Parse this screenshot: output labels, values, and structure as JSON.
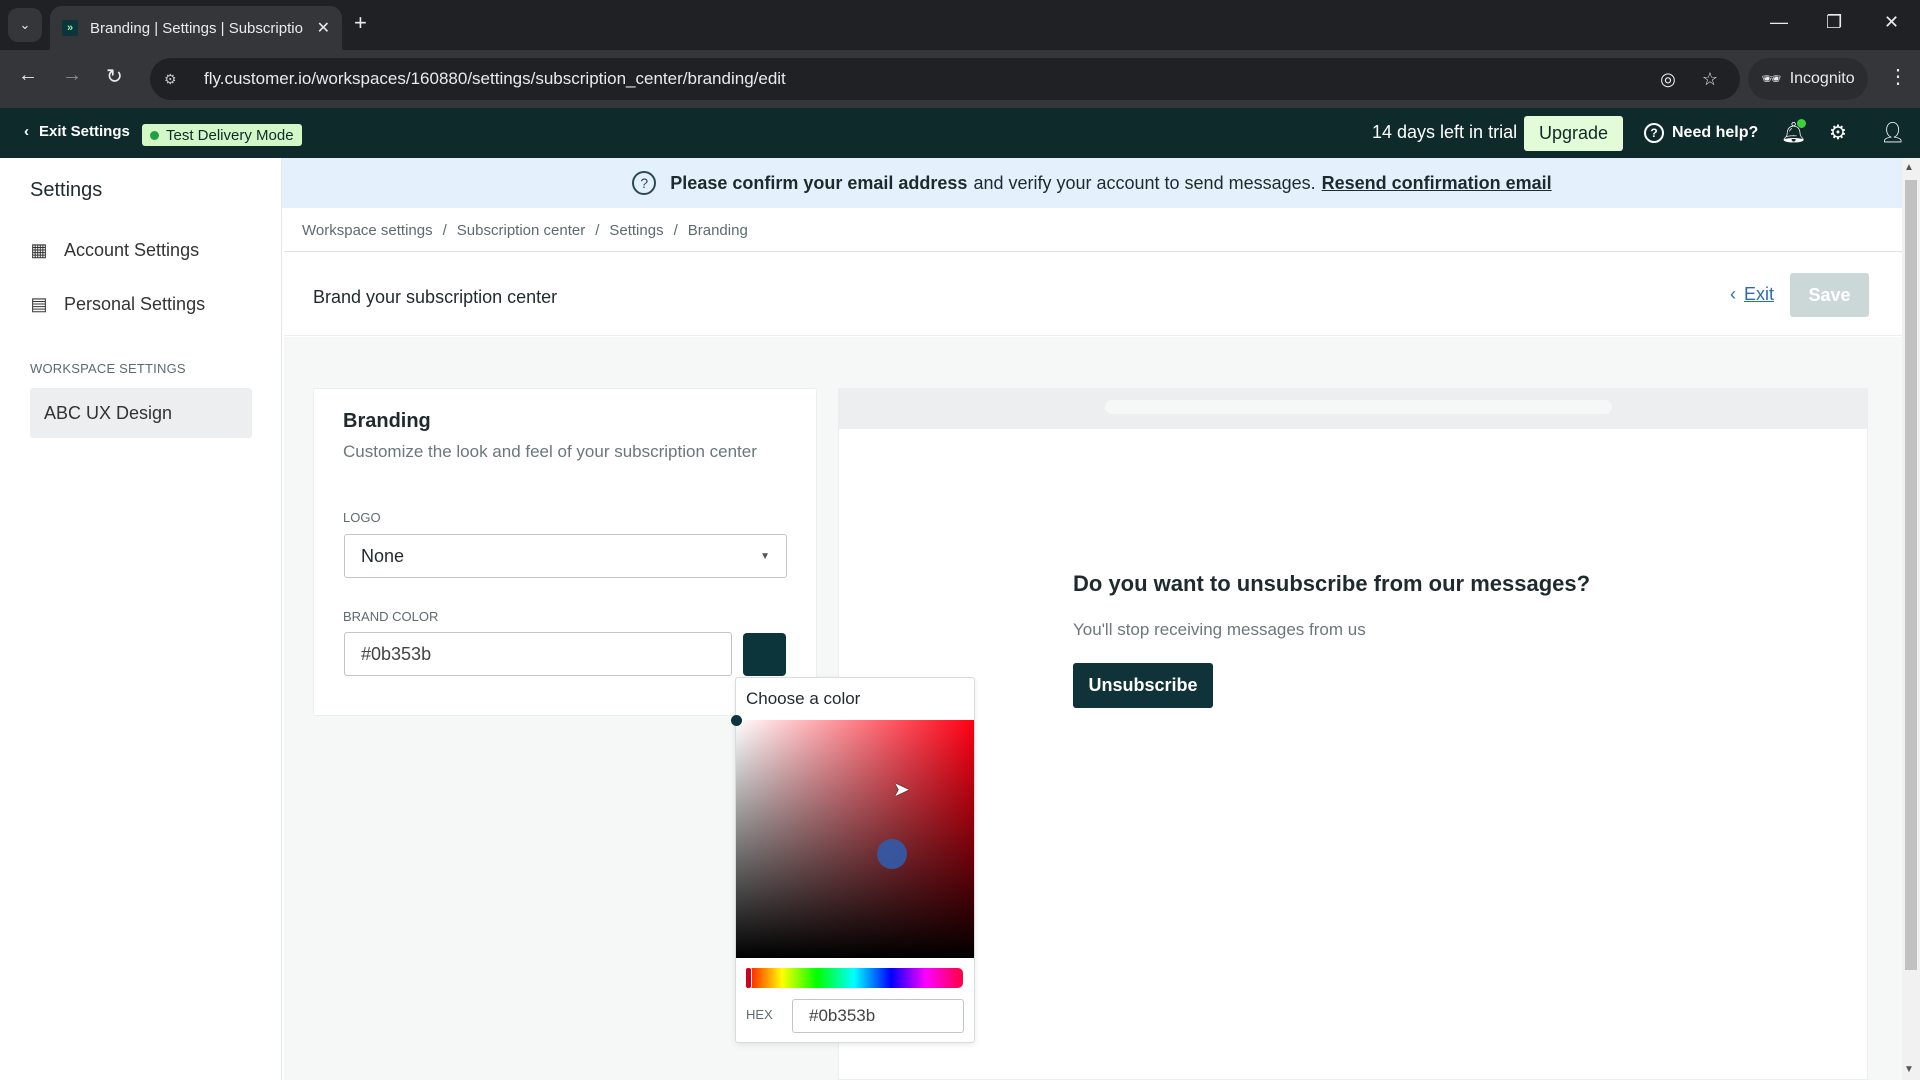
{
  "browser": {
    "tab_title": "Branding | Settings | Subscriptio",
    "url": "fly.customer.io/workspaces/160880/settings/subscription_center/branding/edit",
    "incognito_label": "Incognito",
    "favicon_glyph": "»"
  },
  "app_header": {
    "exit_settings": "Exit Settings",
    "test_mode": "Test Delivery Mode",
    "trial_text": "14 days left in trial",
    "upgrade": "Upgrade",
    "need_help": "Need help?"
  },
  "sidebar": {
    "title": "Settings",
    "items": [
      {
        "label": "Account Settings",
        "icon": "building-icon"
      },
      {
        "label": "Personal Settings",
        "icon": "personal-settings-icon"
      }
    ],
    "section_label": "WORKSPACE SETTINGS",
    "workspace": "ABC UX Design"
  },
  "banner": {
    "bold": "Please confirm your email address",
    "text": "and verify your account to send messages.",
    "link": "Resend confirmation email"
  },
  "breadcrumb": [
    "Workspace settings",
    "Subscription center",
    "Settings",
    "Branding"
  ],
  "breadcrumb_sep": "/",
  "page": {
    "title": "Brand your subscription center",
    "exit": "Exit",
    "save": "Save"
  },
  "branding_card": {
    "title": "Branding",
    "subtitle": "Customize the look and feel of your subscription center",
    "logo_label": "LOGO",
    "logo_value": "None",
    "brand_color_label": "BRAND COLOR",
    "brand_color_value": "#0b353b",
    "swatch_color": "#0b353b"
  },
  "color_picker": {
    "title": "Choose a color",
    "hex_label": "HEX",
    "hex_value": "#0b353b"
  },
  "preview": {
    "question": "Do you want to unsubscribe from our messages?",
    "subtext": "You'll stop receiving messages from us",
    "button": "Unsubscribe"
  }
}
